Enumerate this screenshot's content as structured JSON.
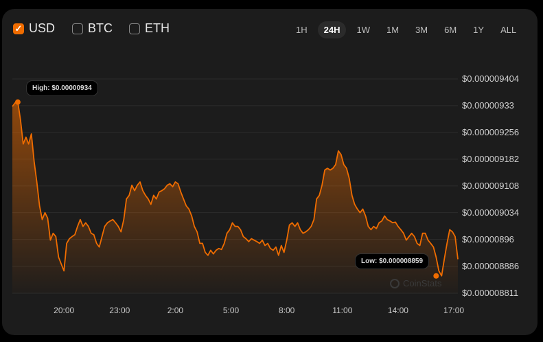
{
  "currencies": [
    {
      "label": "USD",
      "checked": true
    },
    {
      "label": "BTC",
      "checked": false
    },
    {
      "label": "ETH",
      "checked": false
    }
  ],
  "ranges": [
    "1H",
    "24H",
    "1W",
    "1M",
    "3M",
    "6M",
    "1Y",
    "ALL"
  ],
  "active_range": "24H",
  "high_label": "High: $0.00000934",
  "low_label": "Low: $0.000008859",
  "watermark": "CoinStats",
  "colors": {
    "line": "#ef6c00",
    "card": "#1c1c1c",
    "grid": "#2c2c2c"
  },
  "chart_data": {
    "type": "area",
    "title": "",
    "unit_note": "values in 1e-9 USD",
    "x_span_hours": 24,
    "start_hour": 17.22,
    "yticks": [
      {
        "v": 9404,
        "label": "$0.000009404"
      },
      {
        "v": 9330,
        "label": "$0.00000933"
      },
      {
        "v": 9256,
        "label": "$0.000009256"
      },
      {
        "v": 9182,
        "label": "$0.000009182"
      },
      {
        "v": 9108,
        "label": "$0.000009108"
      },
      {
        "v": 9034,
        "label": "$0.000009034"
      },
      {
        "v": 8960,
        "label": "$0.00000896"
      },
      {
        "v": 8886,
        "label": "$0.000008886"
      },
      {
        "v": 8811,
        "label": "$0.000008811"
      }
    ],
    "xticks": [
      {
        "h": 20,
        "label": "20:00"
      },
      {
        "h": 23,
        "label": "23:00"
      },
      {
        "h": 26,
        "label": "2:00"
      },
      {
        "h": 29,
        "label": "5:00"
      },
      {
        "h": 32,
        "label": "8:00"
      },
      {
        "h": 35,
        "label": "11:00"
      },
      {
        "h": 38,
        "label": "14:00"
      },
      {
        "h": 41,
        "label": "17:00"
      }
    ],
    "ylim": [
      8811,
      9404
    ],
    "high": {
      "value": 9340,
      "index": 2
    },
    "low": {
      "value": 8859,
      "index": 156
    },
    "values": [
      9328,
      9338,
      9341,
      9290,
      9224,
      9243,
      9224,
      9252,
      9176,
      9119,
      9053,
      9015,
      9034,
      9019,
      8958,
      8977,
      8968,
      8911,
      8892,
      8873,
      8949,
      8962,
      8968,
      8973,
      8996,
      9015,
      8996,
      9006,
      8996,
      8977,
      8973,
      8949,
      8939,
      8968,
      8996,
      9006,
      9011,
      9015,
      9006,
      8996,
      8981,
      9015,
      9072,
      9082,
      9110,
      9095,
      9110,
      9119,
      9095,
      9082,
      9072,
      9057,
      9082,
      9072,
      9091,
      9095,
      9100,
      9110,
      9114,
      9106,
      9119,
      9114,
      9091,
      9072,
      9053,
      9044,
      9025,
      8996,
      8981,
      8949,
      8949,
      8924,
      8916,
      8930,
      8920,
      8930,
      8935,
      8932,
      8949,
      8977,
      8987,
      9006,
      8996,
      8996,
      8987,
      8968,
      8962,
      8954,
      8962,
      8958,
      8954,
      8949,
      8958,
      8943,
      8949,
      8935,
      8930,
      8939,
      8916,
      8943,
      8924,
      8958,
      9000,
      9006,
      8996,
      9006,
      8987,
      8977,
      8981,
      8987,
      8996,
      9015,
      9072,
      9082,
      9110,
      9152,
      9157,
      9152,
      9157,
      9167,
      9205,
      9195,
      9167,
      9157,
      9129,
      9082,
      9057,
      9044,
      9034,
      9044,
      9025,
      8996,
      8987,
      8996,
      8990,
      9006,
      9011,
      9025,
      9015,
      9011,
      9006,
      9008,
      8996,
      8987,
      8977,
      8958,
      8968,
      8977,
      8968,
      8949,
      8943,
      8977,
      8977,
      8958,
      8949,
      8939,
      8911,
      8873,
      8859,
      8905,
      8949,
      8987,
      8981,
      8968,
      8905
    ]
  }
}
